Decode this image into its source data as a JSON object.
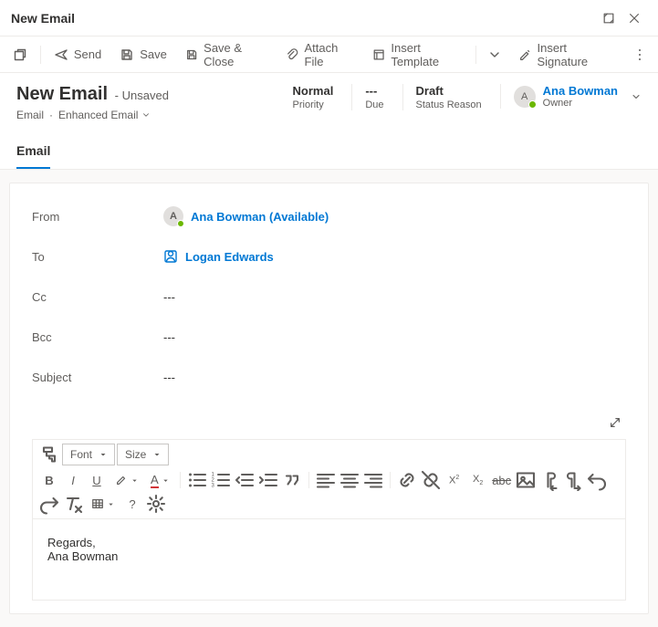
{
  "titlebar": {
    "title": "New Email"
  },
  "commands": {
    "send": "Send",
    "save": "Save",
    "save_close": "Save & Close",
    "attach": "Attach File",
    "insert_template": "Insert Template",
    "insert_signature": "Insert Signature"
  },
  "header": {
    "title": "New Email",
    "unsaved": "- Unsaved",
    "entity": "Email",
    "form_name": "Enhanced Email"
  },
  "meta": {
    "priority_val": "Normal",
    "priority_lbl": "Priority",
    "due_val": "---",
    "due_lbl": "Due",
    "status_val": "Draft",
    "status_lbl": "Status Reason"
  },
  "owner": {
    "initial": "A",
    "name": "Ana Bowman",
    "lbl": "Owner"
  },
  "tabs": {
    "email": "Email"
  },
  "form": {
    "from_lbl": "From",
    "from_val": "Ana Bowman (Available)",
    "from_initial": "A",
    "to_lbl": "To",
    "to_val": "Logan Edwards",
    "cc_lbl": "Cc",
    "cc_val": "---",
    "bcc_lbl": "Bcc",
    "bcc_val": "---",
    "subject_lbl": "Subject",
    "subject_val": "---"
  },
  "rte": {
    "font_lbl": "Font",
    "size_lbl": "Size",
    "body_line1": "Regards,",
    "body_line2": "Ana Bowman"
  }
}
